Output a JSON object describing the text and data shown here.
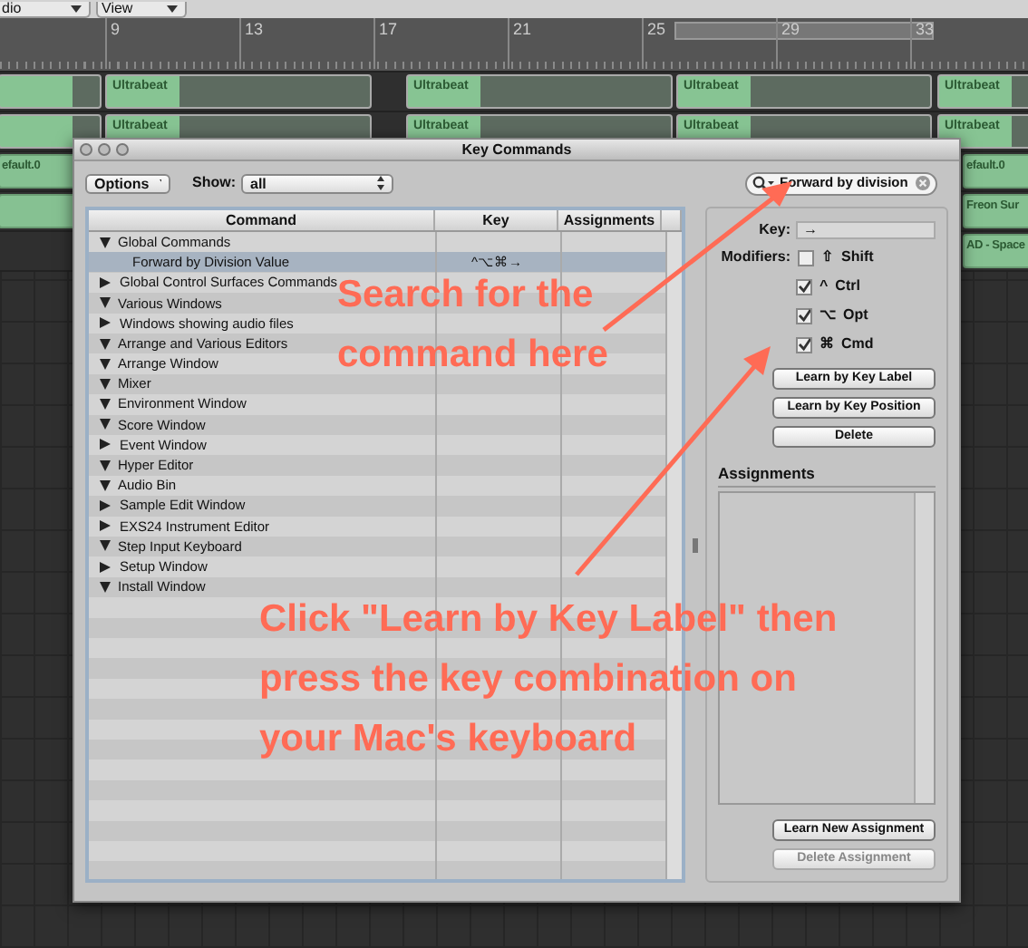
{
  "menu": [
    {
      "label": "dio"
    },
    {
      "label": "View"
    }
  ],
  "ruler": {
    "labels": [
      "9",
      "13",
      "17",
      "21",
      "25",
      "29",
      "33"
    ],
    "cycle": true
  },
  "tracks": [
    {
      "regions": [
        {
          "kind": "pattern"
        },
        {
          "kind": "pattern",
          "label": "Ultrabeat"
        },
        {
          "kind": "pattern",
          "label": "Ultrabeat"
        },
        {
          "kind": "pattern",
          "label": "Ultrabeat"
        },
        {
          "kind": "pattern",
          "label": "Ultrabeat"
        }
      ]
    },
    {
      "regions": [
        {
          "kind": "pattern"
        },
        {
          "kind": "pattern",
          "label": "Ultrabeat"
        },
        {
          "kind": "pattern",
          "label": "Ultrabeat"
        },
        {
          "kind": "pattern",
          "label": "Ultrabeat"
        },
        {
          "kind": "pattern",
          "label": "Ultrabeat"
        }
      ]
    },
    {
      "regions": [
        {
          "kind": "audio",
          "label": "efault.0"
        },
        {
          "kind": "audio",
          "label": "efault.0"
        }
      ]
    },
    {
      "regions": [
        {
          "kind": "audio"
        },
        {
          "kind": "audio",
          "label": "Freon Sur"
        }
      ]
    },
    {
      "regions": [
        {
          "kind": "audio",
          "label": "AD - Space"
        }
      ]
    }
  ],
  "window": {
    "title": "Key Commands",
    "options": "Options",
    "show_label": "Show:",
    "show_value": "all",
    "search": {
      "value": "Forward by division"
    },
    "table": {
      "columns": [
        "Command",
        "Key",
        "Assignments"
      ],
      "rows": [
        {
          "command": "Global Commands",
          "expanded": true,
          "children": [
            {
              "command": "Forward by Division Value",
              "key": "^⌥⌘→",
              "selected": true
            }
          ]
        },
        {
          "command": "Global Control Surfaces Commands",
          "expanded": false
        },
        {
          "command": "Various Windows",
          "expanded": true
        },
        {
          "command": "Windows showing audio files",
          "expanded": false
        },
        {
          "command": "Arrange and Various Editors",
          "expanded": true
        },
        {
          "command": "Arrange Window",
          "expanded": true
        },
        {
          "command": "Mixer",
          "expanded": true
        },
        {
          "command": "Environment Window",
          "expanded": true
        },
        {
          "command": "Score Window",
          "expanded": true
        },
        {
          "command": "Event Window",
          "expanded": false
        },
        {
          "command": "Hyper Editor",
          "expanded": true
        },
        {
          "command": "Audio Bin",
          "expanded": true
        },
        {
          "command": "Sample Edit Window",
          "expanded": false
        },
        {
          "command": "EXS24 Instrument Editor",
          "expanded": false
        },
        {
          "command": "Step Input Keyboard",
          "expanded": true
        },
        {
          "command": "Setup Window",
          "expanded": false
        },
        {
          "command": "Install Window",
          "expanded": true
        }
      ]
    },
    "key_label": "Key:",
    "key_value": "→",
    "modifiers_label": "Modifiers:",
    "modifiers": [
      {
        "symbol": "⇧",
        "label": "Shift",
        "checked": false
      },
      {
        "symbol": "^",
        "label": "Ctrl",
        "checked": true
      },
      {
        "symbol": "⌥",
        "label": "Opt",
        "checked": true
      },
      {
        "symbol": "⌘",
        "label": "Cmd",
        "checked": true
      }
    ],
    "buttons": [
      {
        "label": "Learn by Key Label",
        "disabled": false
      },
      {
        "label": "Learn by Key Position",
        "disabled": false
      },
      {
        "label": "Delete",
        "disabled": false
      }
    ],
    "assignments_label": "Assignments",
    "assignment_buttons": [
      {
        "label": "Learn New Assignment",
        "disabled": false
      },
      {
        "label": "Delete Assignment",
        "disabled": true
      }
    ]
  },
  "annotations": [
    {
      "text": "Search for the\ncommand here"
    },
    {
      "text": "Click \"Learn by Key Label\" then\npress the key combination on\nyour Mac's keyboard"
    }
  ]
}
